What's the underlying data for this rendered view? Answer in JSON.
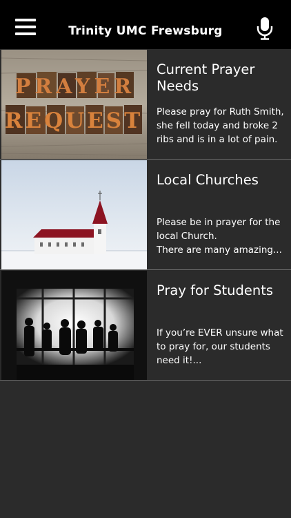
{
  "header": {
    "title": "Trinity UMC Frewsburg",
    "menu_icon": "hamburger-menu-icon",
    "mic_icon": "microphone-icon"
  },
  "feed": [
    {
      "title": "Current Prayer Needs",
      "title_lines": [
        "Current Prayer",
        "Needs"
      ],
      "description_lines": [
        "Please pray for Ruth Smith,",
        "she fell today and broke 2",
        "ribs and is in a lot of pain."
      ],
      "image_text_top": "PRAYER",
      "image_text_bottom": "REQUEST"
    },
    {
      "title": "Local Churches",
      "description_lines": [
        "Please be in prayer for the",
        "local Church.",
        "There are many amazing..."
      ]
    },
    {
      "title": "Pray for Students",
      "description_lines": [
        "If you’re EVER unsure what",
        "to pray for, our students",
        "need it!..."
      ]
    }
  ],
  "colors": {
    "header_bg": "#000000",
    "list_bg": "#2b2b2b",
    "divider": "#6b6b6b",
    "text": "#ffffff"
  }
}
